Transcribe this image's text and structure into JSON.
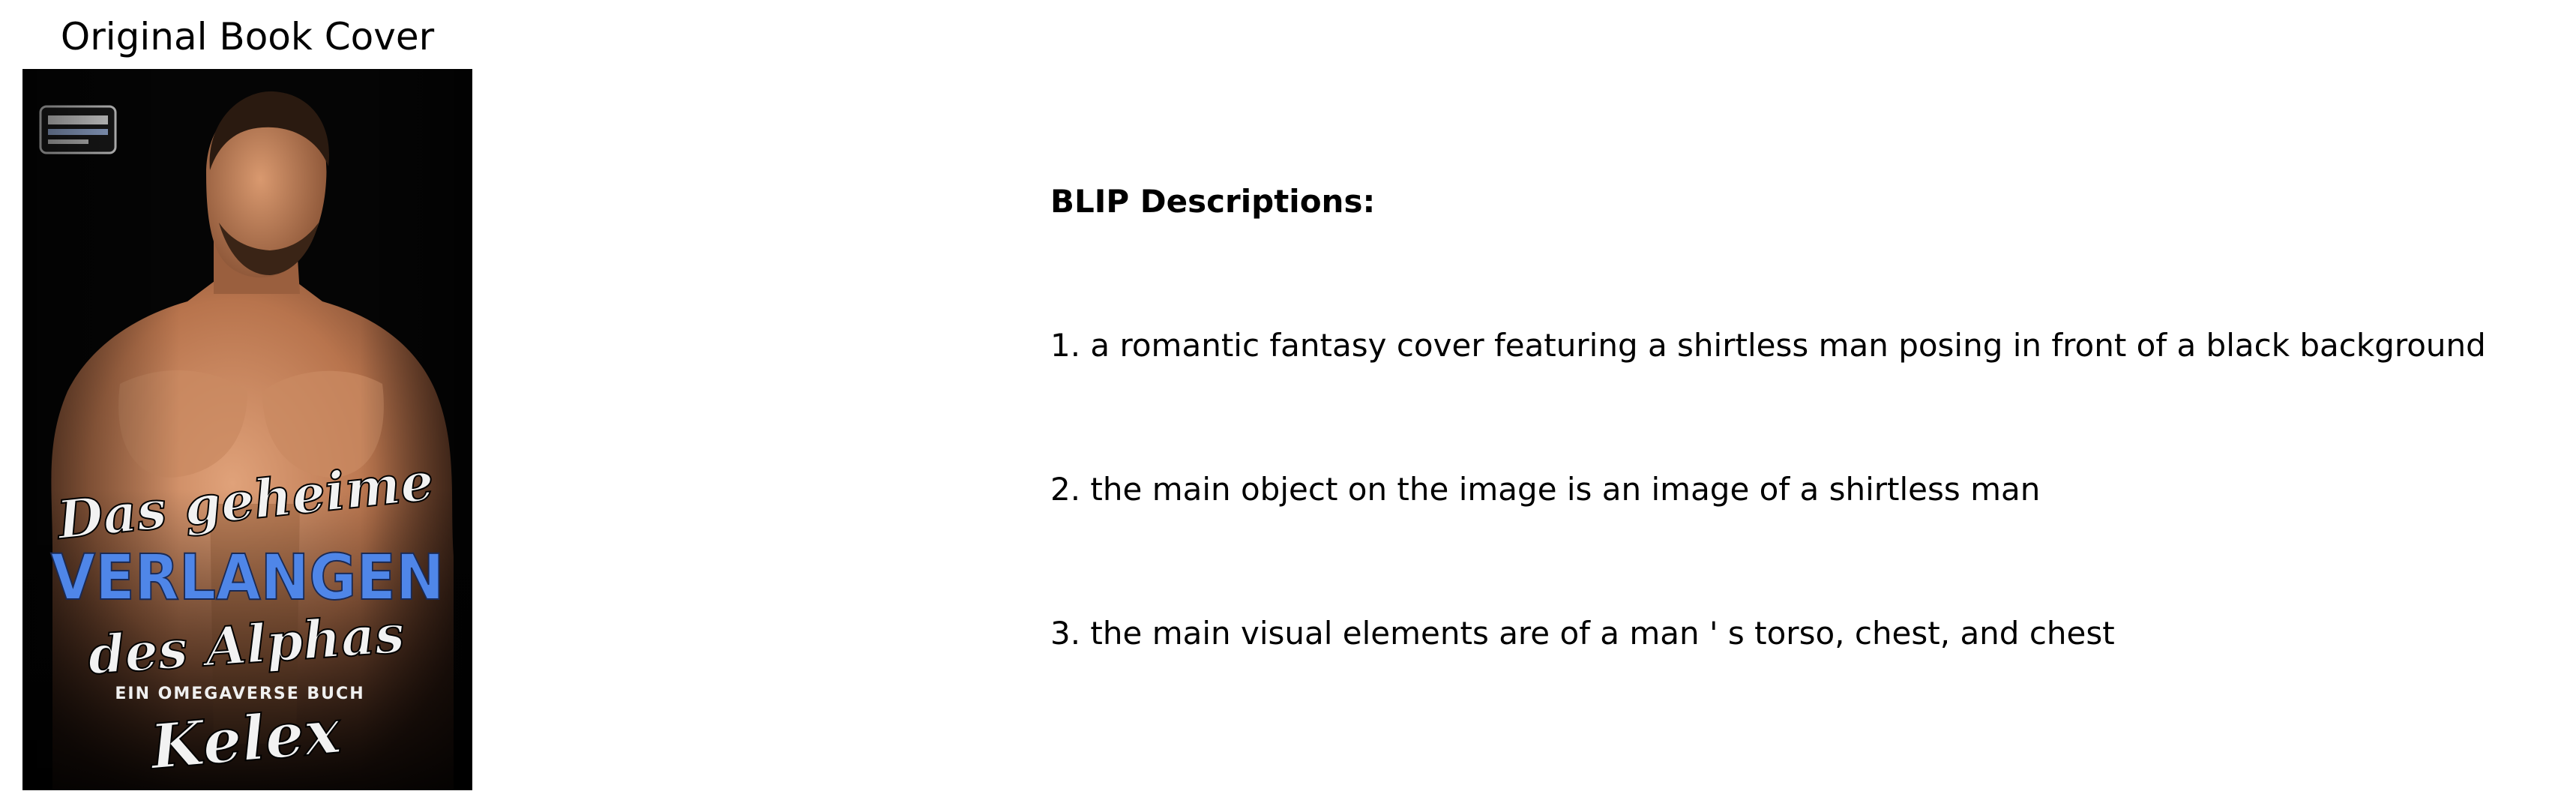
{
  "left_panel": {
    "title": "Original Book Cover",
    "cover": {
      "line1": "Das geheime",
      "line2": "VERLANGEN",
      "line3": "des Alphas",
      "tagline": "EIN OMEGAVERSE BUCH",
      "author": "Kelex",
      "accent_color": "#4f86e8",
      "background_color": "#000000"
    }
  },
  "right_panel": {
    "heading": "BLIP Descriptions:",
    "descriptions": [
      "1. a romantic fantasy cover featuring a shirtless man posing in front of a black background",
      "2. the main object on the image is an image of a shirtless man",
      "3. the main visual elements are of a man ' s torso, chest, and chest"
    ]
  }
}
